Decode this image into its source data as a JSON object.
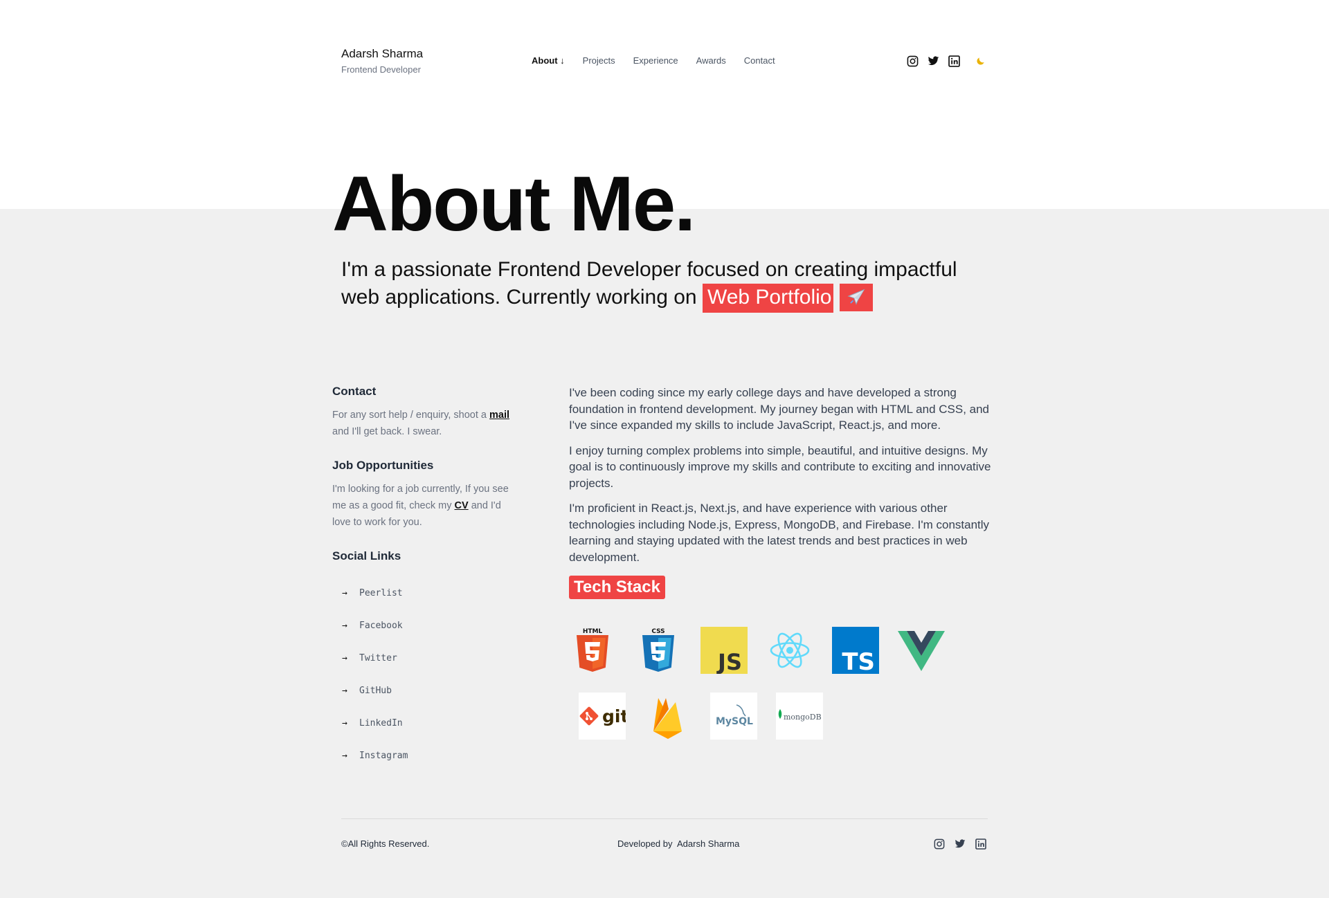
{
  "header": {
    "name": "Adarsh Sharma",
    "role": "Frontend Developer",
    "nav": [
      {
        "label": "About ↓"
      },
      {
        "label": "Projects"
      },
      {
        "label": "Experience"
      },
      {
        "label": "Awards"
      },
      {
        "label": "Contact"
      }
    ],
    "icons": [
      "instagram-icon",
      "twitter-icon",
      "linkedin-icon",
      "moon-icon"
    ]
  },
  "hero": {
    "title": "About Me.",
    "tagline": "I'm a passionate Frontend Developer focused on creating impactful web applications. Currently working on",
    "highlight": "Web Portfolio",
    "emoji": "✈️"
  },
  "contact": {
    "title": "Contact",
    "text_before": "For any sort help / enquiry, shoot a",
    "link": "mail",
    "text_after": "and I'll get back. I swear."
  },
  "jobs": {
    "title": "Job Opportunities",
    "text_before": "I'm looking for a job currently, If you see me as a good fit, check my",
    "link": "CV",
    "text_after": "and I'd love to work for you."
  },
  "social": {
    "title": "Social Links",
    "arrow": "→",
    "items": [
      "Peerlist",
      "Facebook",
      "Twitter",
      "GitHub",
      "LinkedIn",
      "Instagram"
    ]
  },
  "about": {
    "paragraphs": [
      "I've been coding since my early college days and have developed a strong foundation in frontend development. My journey began with HTML and CSS, and I've since expanded my skills to include JavaScript, React.js, and more.",
      "I enjoy turning complex problems into simple, beautiful, and intuitive designs. My goal is to continuously improve my skills and contribute to exciting and innovative projects.",
      "I'm proficient in React.js, Next.js, and have experience with various other technologies including Node.js, Express, MongoDB, and Firebase. I'm constantly learning and staying updated with the latest trends and best practices in web development."
    ],
    "tech_title": "Tech Stack",
    "tech_icons": [
      "html5-icon",
      "css3-icon",
      "javascript-icon",
      "react-icon",
      "typescript-icon",
      "vue-icon",
      "git-icon",
      "firebase-icon",
      "mysql-icon",
      "mongodb-icon"
    ],
    "tech_labels": {
      "html": "HTML",
      "css": "CSS",
      "js": "JS",
      "ts": "TS",
      "git": "git",
      "mysql": "MySQL",
      "mongodb": "mongoDB"
    }
  },
  "footer": {
    "rights": "©All Rights Reserved.",
    "developed": "Developed by  Adarsh Sharma"
  },
  "colors": {
    "accent": "#ef4444",
    "background": "#f0f0f0",
    "moon": "#eab308"
  }
}
